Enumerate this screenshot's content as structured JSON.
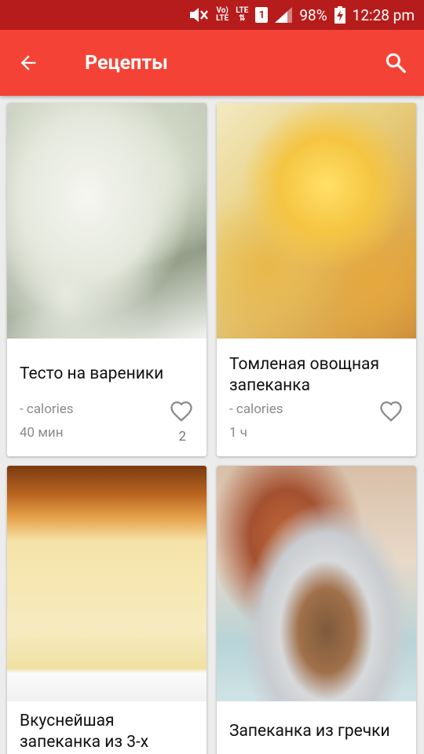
{
  "status_bar": {
    "volte_top": "Vo)",
    "volte_bottom": "LTE",
    "lte_top": "LTE",
    "lte_bottom": "⇅",
    "sim_slot": "1",
    "battery": "98%",
    "time": "12:28 pm"
  },
  "app_bar": {
    "title": "Рецепты",
    "back_icon": "arrow-left-icon",
    "search_icon": "search-icon"
  },
  "colors": {
    "status_bar": "#b71c1c",
    "app_bar": "#f44336"
  },
  "recipes": [
    {
      "name": "Тесто на вареники",
      "calories": "- calories",
      "time": "40 мин",
      "likes": "2"
    },
    {
      "name": "Томленая овощная запеканка",
      "calories": "- calories",
      "time": "1 ч",
      "likes": ""
    },
    {
      "name": "Вкуснейшая запеканка из 3-х",
      "calories": "",
      "time": "",
      "likes": ""
    },
    {
      "name": "Запеканка из гречки",
      "calories": "",
      "time": "",
      "likes": ""
    }
  ]
}
